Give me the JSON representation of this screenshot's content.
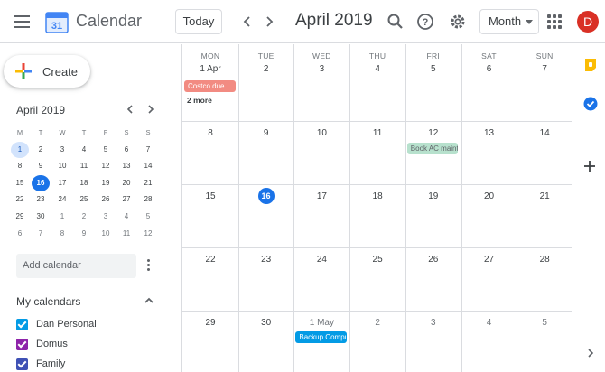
{
  "header": {
    "app_title": "Calendar",
    "logo_day": "31",
    "today_label": "Today",
    "prev_icon": "chevron-left",
    "next_icon": "chevron-right",
    "month_title": "April 2019",
    "view_label": "Month",
    "avatar_initial": "D",
    "avatar_color": "#d93025"
  },
  "sidebar": {
    "create_label": "Create",
    "mini_title": "April 2019",
    "mini_days": [
      "M",
      "T",
      "W",
      "T",
      "F",
      "S",
      "S"
    ],
    "mini_weeks": [
      [
        "1",
        "2",
        "3",
        "4",
        "5",
        "6",
        "7"
      ],
      [
        "8",
        "9",
        "10",
        "11",
        "12",
        "13",
        "14"
      ],
      [
        "15",
        "16",
        "17",
        "18",
        "19",
        "20",
        "21"
      ],
      [
        "22",
        "23",
        "24",
        "25",
        "26",
        "27",
        "28"
      ],
      [
        "29",
        "30",
        "1",
        "2",
        "3",
        "4",
        "5"
      ],
      [
        "6",
        "7",
        "8",
        "9",
        "10",
        "11",
        "12"
      ]
    ],
    "add_calendar_placeholder": "Add calendar",
    "my_calendars_title": "My calendars",
    "calendars": [
      {
        "name": "Dan Personal",
        "color": "#039be5",
        "checked": true
      },
      {
        "name": "Domus",
        "color": "#8e24aa",
        "checked": true
      },
      {
        "name": "Family",
        "color": "#3f51b5",
        "checked": true
      }
    ]
  },
  "grid": {
    "days": [
      "MON",
      "TUE",
      "WED",
      "THU",
      "FRI",
      "SAT",
      "SUN"
    ],
    "weeks": [
      [
        "1 Apr",
        "2",
        "3",
        "4",
        "5",
        "6",
        "7"
      ],
      [
        "8",
        "9",
        "10",
        "11",
        "12",
        "13",
        "14"
      ],
      [
        "15",
        "16",
        "17",
        "18",
        "19",
        "20",
        "21"
      ],
      [
        "22",
        "23",
        "24",
        "25",
        "26",
        "27",
        "28"
      ],
      [
        "29",
        "30",
        "1 May",
        "2",
        "3",
        "4",
        "5"
      ]
    ],
    "today": "16",
    "events": {
      "costco": {
        "title": "Costco due",
        "bg": "#f28b82",
        "fg": "#fff"
      },
      "more": "2 more",
      "ac": {
        "title": "Book AC maintenance",
        "bg": "#b7e1cd",
        "fg": "#5f6368"
      },
      "backup": {
        "title": "Backup Computer",
        "bg": "#039be5",
        "fg": "#fff"
      }
    }
  },
  "rail": {
    "keep_color": "#fbbc04",
    "tasks_color": "#1a73e8"
  }
}
